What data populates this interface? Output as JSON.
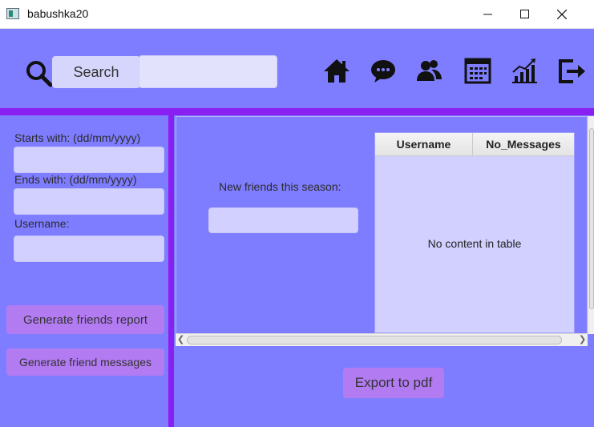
{
  "window": {
    "title": "babushka20"
  },
  "toolbar": {
    "search_label": "Search",
    "search_value": "",
    "nav_icons": [
      "home-icon",
      "chat-icon",
      "friends-icon",
      "calendar-icon",
      "stats-icon",
      "logout-icon"
    ]
  },
  "filters": {
    "starts_label": "Starts with: (dd/mm/yyyy)",
    "starts_value": "",
    "ends_label": "Ends with: (dd/mm/yyyy)",
    "ends_value": "",
    "username_label": "Username:",
    "username_value": ""
  },
  "actions": {
    "generate_report": "Generate friends report",
    "generate_messages": "Generate friend messages",
    "export_pdf": "Export to pdf"
  },
  "stats": {
    "new_friends_label": "New friends this season:",
    "new_friends_value": ""
  },
  "table": {
    "columns": [
      "Username",
      "No_Messages"
    ],
    "rows": [],
    "empty_message": "No content in table"
  },
  "colors": {
    "background": "#7f7dff",
    "accent_bar": "#8a1ff2",
    "button": "#b27bf2",
    "field": "#d1d0ff"
  }
}
